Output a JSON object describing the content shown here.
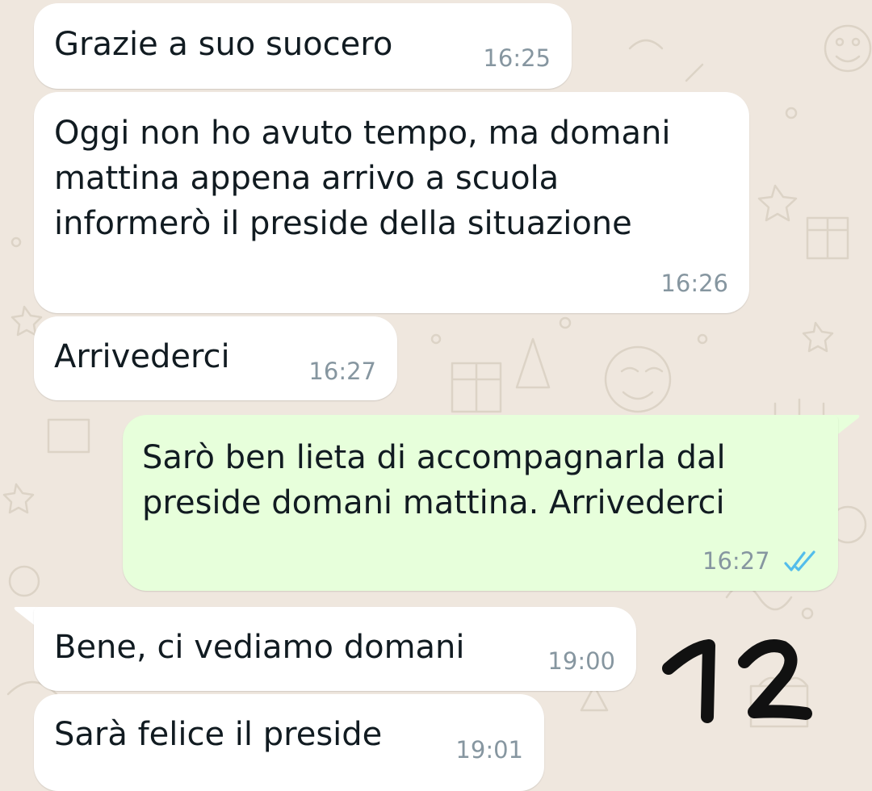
{
  "messages": [
    {
      "direction": "incoming",
      "text": "Grazie a suo suocero",
      "time": "16:25"
    },
    {
      "direction": "incoming",
      "text": "Oggi non ho avuto tempo, ma domani\nmattina appena arrivo a scuola\ninformerò il preside della situazione",
      "time": "16:26"
    },
    {
      "direction": "incoming",
      "text": "Arrivederci",
      "time": "16:27"
    },
    {
      "direction": "outgoing",
      "text": "Sarò ben lieta di accompagnarla dal\npreside domani mattina. Arrivederci",
      "time": "16:27",
      "status": "read",
      "status_icon": "double-check-icon"
    },
    {
      "direction": "incoming",
      "text": "Bene, ci vediamo domani",
      "time": "19:00"
    },
    {
      "direction": "incoming",
      "text": "Sarà felice il preside",
      "time": "19:01"
    }
  ],
  "annotation": {
    "text": "12",
    "color": "#111111"
  },
  "colors": {
    "background": "#efe7de",
    "incoming_bubble": "#ffffff",
    "outgoing_bubble": "#e7ffdb",
    "message_text": "#111b21",
    "timestamp": "#8696a0",
    "read_ticks": "#53bdeb"
  }
}
